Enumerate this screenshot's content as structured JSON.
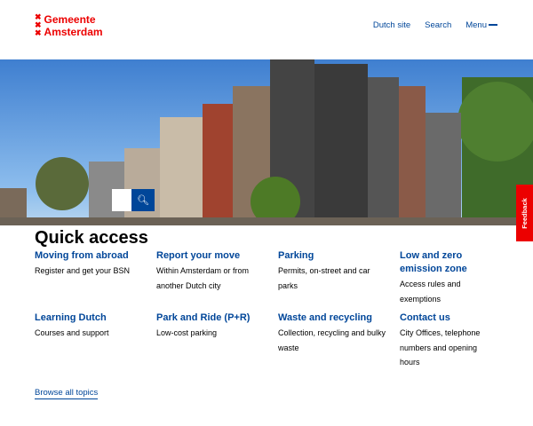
{
  "header": {
    "logo_line1": "Gemeente",
    "logo_line2": "Amsterdam",
    "nav": [
      "Dutch site",
      "Search",
      "Menu"
    ]
  },
  "search": {
    "placeholder": ""
  },
  "feedback": "Feedback",
  "quick_access": {
    "title": "Quick access",
    "items": [
      {
        "title": "Moving from abroad",
        "desc": "Register and get your BSN"
      },
      {
        "title": "Report your move",
        "desc": "Within Amsterdam or from another Dutch city"
      },
      {
        "title": "Parking",
        "desc": "Permits, on-street and car parks"
      },
      {
        "title": "Low and zero emission zone",
        "desc": "Access rules and exemptions"
      },
      {
        "title": "Learning Dutch",
        "desc": "Courses and support"
      },
      {
        "title": "Park and Ride (P+R)",
        "desc": "Low-cost parking"
      },
      {
        "title": "Waste and recycling",
        "desc": "Collection, recycling and bulky waste"
      },
      {
        "title": "Contact us",
        "desc": "City Offices, telephone numbers and opening hours"
      }
    ]
  },
  "browse_all": "Browse all topics"
}
